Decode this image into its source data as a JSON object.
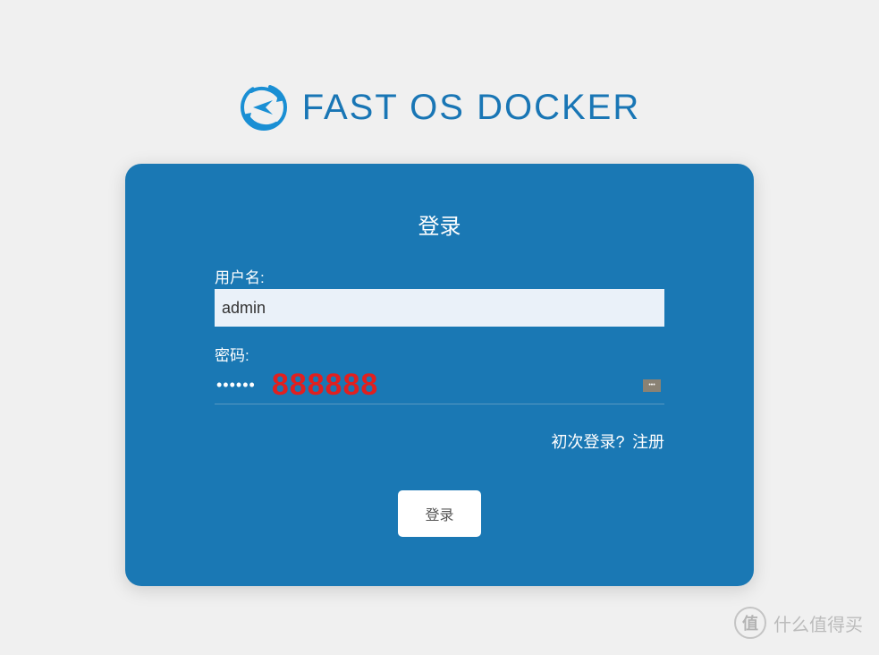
{
  "header": {
    "title": "FAST OS DOCKER"
  },
  "login": {
    "title": "登录",
    "username_label": "用户名:",
    "username_value": "admin",
    "password_label": "密码:",
    "password_dots": "••••••",
    "password_overlay": "888888",
    "first_login_text": "初次登录?",
    "register_label": "注册",
    "login_button_label": "登录"
  },
  "watermark": {
    "badge": "值",
    "text": "什么值得买"
  },
  "colors": {
    "primary": "#1a78b4",
    "title_blue": "#1976b5",
    "overlay_red": "#e02020",
    "input_bg": "#eaf1f9"
  }
}
